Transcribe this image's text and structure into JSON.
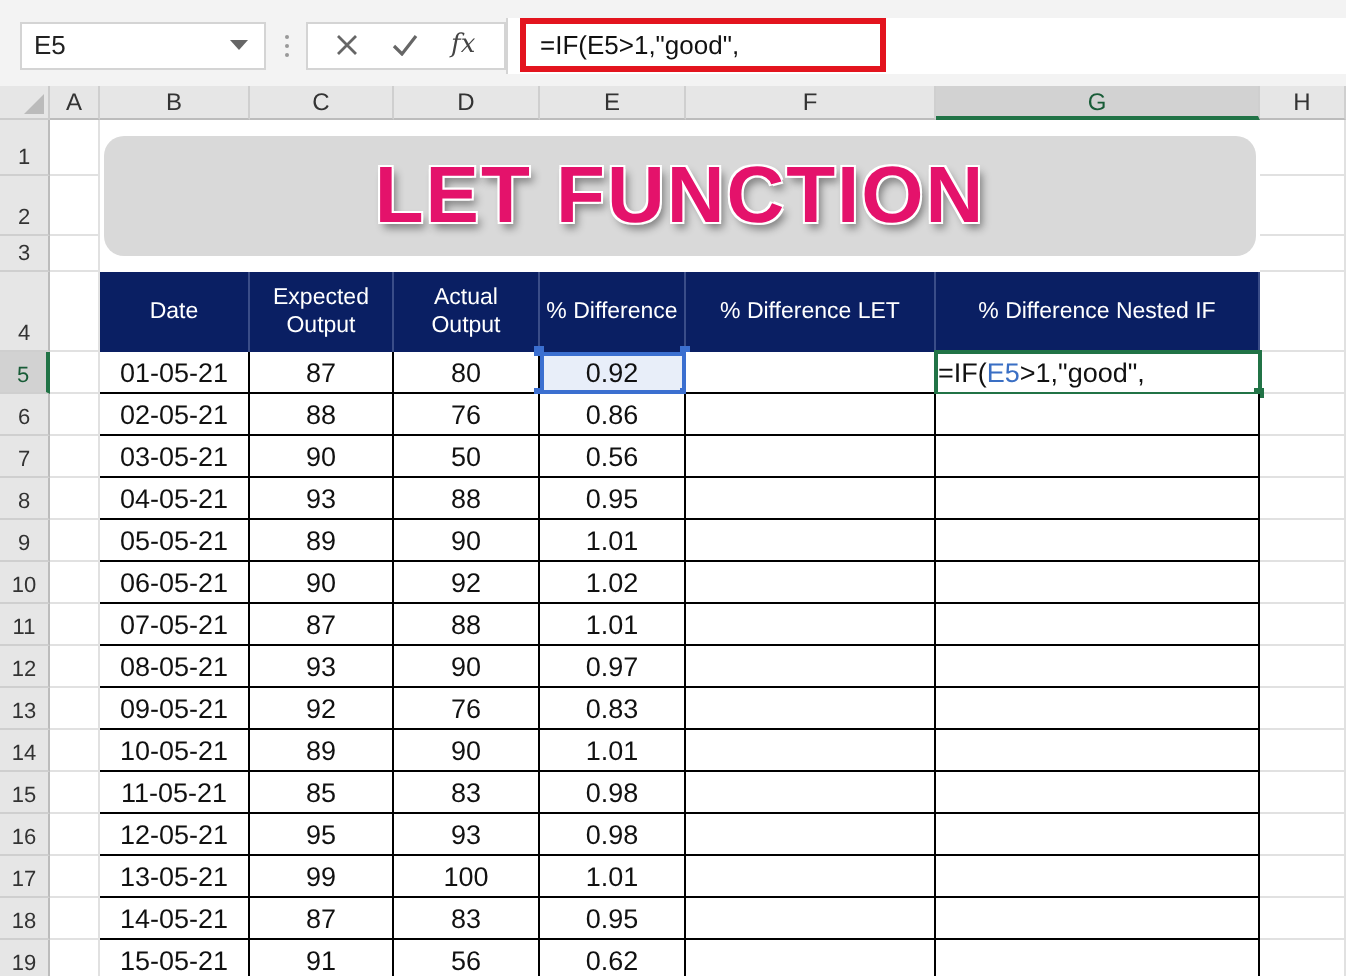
{
  "name_box": {
    "value": "E5"
  },
  "formula_bar": {
    "function_label": "fx",
    "formula": "=IF(E5>1,\"good\",",
    "highlighted": true
  },
  "column_headers": [
    {
      "label": "A",
      "selected": false
    },
    {
      "label": "B",
      "selected": false
    },
    {
      "label": "C",
      "selected": false
    },
    {
      "label": "D",
      "selected": false
    },
    {
      "label": "E",
      "selected": false
    },
    {
      "label": "F",
      "selected": false
    },
    {
      "label": "G",
      "selected": true
    },
    {
      "label": "H",
      "selected": false
    }
  ],
  "row_headers": [
    {
      "label": "1",
      "selected": false
    },
    {
      "label": "2",
      "selected": false
    },
    {
      "label": "3",
      "selected": false
    },
    {
      "label": "4",
      "selected": false
    },
    {
      "label": "5",
      "selected": true
    },
    {
      "label": "6",
      "selected": false
    },
    {
      "label": "7",
      "selected": false
    },
    {
      "label": "8",
      "selected": false
    },
    {
      "label": "9",
      "selected": false
    },
    {
      "label": "10",
      "selected": false
    },
    {
      "label": "11",
      "selected": false
    },
    {
      "label": "12",
      "selected": false
    },
    {
      "label": "13",
      "selected": false
    },
    {
      "label": "14",
      "selected": false
    },
    {
      "label": "15",
      "selected": false
    },
    {
      "label": "16",
      "selected": false
    },
    {
      "label": "17",
      "selected": false
    },
    {
      "label": "18",
      "selected": false
    },
    {
      "label": "19",
      "selected": false
    }
  ],
  "title": "LET FUNCTION",
  "table": {
    "columns": [
      "Date",
      "Expected Output",
      "Actual Output",
      "% Difference",
      "% Difference LET",
      "% Difference Nested IF"
    ],
    "rows": [
      {
        "date": "01-05-21",
        "expected": "87",
        "actual": "80",
        "difference": "0.92",
        "selected": true,
        "nested_if": {
          "editing": true,
          "parts": [
            {
              "text": "=IF(",
              "kind": "plain"
            },
            {
              "text": "E5",
              "kind": "reference"
            },
            {
              "text": ">1,\"good\",",
              "kind": "plain"
            }
          ]
        }
      },
      {
        "date": "02-05-21",
        "expected": "88",
        "actual": "76",
        "difference": "0.86",
        "selected": false
      },
      {
        "date": "03-05-21",
        "expected": "90",
        "actual": "50",
        "difference": "0.56",
        "selected": false
      },
      {
        "date": "04-05-21",
        "expected": "93",
        "actual": "88",
        "difference": "0.95",
        "selected": false
      },
      {
        "date": "05-05-21",
        "expected": "89",
        "actual": "90",
        "difference": "1.01",
        "selected": false
      },
      {
        "date": "06-05-21",
        "expected": "90",
        "actual": "92",
        "difference": "1.02",
        "selected": false
      },
      {
        "date": "07-05-21",
        "expected": "87",
        "actual": "88",
        "difference": "1.01",
        "selected": false
      },
      {
        "date": "08-05-21",
        "expected": "93",
        "actual": "90",
        "difference": "0.97",
        "selected": false
      },
      {
        "date": "09-05-21",
        "expected": "92",
        "actual": "76",
        "difference": "0.83",
        "selected": false
      },
      {
        "date": "10-05-21",
        "expected": "89",
        "actual": "90",
        "difference": "1.01",
        "selected": false
      },
      {
        "date": "11-05-21",
        "expected": "85",
        "actual": "83",
        "difference": "0.98",
        "selected": false
      },
      {
        "date": "12-05-21",
        "expected": "95",
        "actual": "93",
        "difference": "0.98",
        "selected": false
      },
      {
        "date": "13-05-21",
        "expected": "99",
        "actual": "100",
        "difference": "1.01",
        "selected": false
      },
      {
        "date": "14-05-21",
        "expected": "87",
        "actual": "83",
        "difference": "0.95",
        "selected": false
      },
      {
        "date": "15-05-21",
        "expected": "91",
        "actual": "56",
        "difference": "0.62",
        "selected": false
      }
    ]
  }
}
